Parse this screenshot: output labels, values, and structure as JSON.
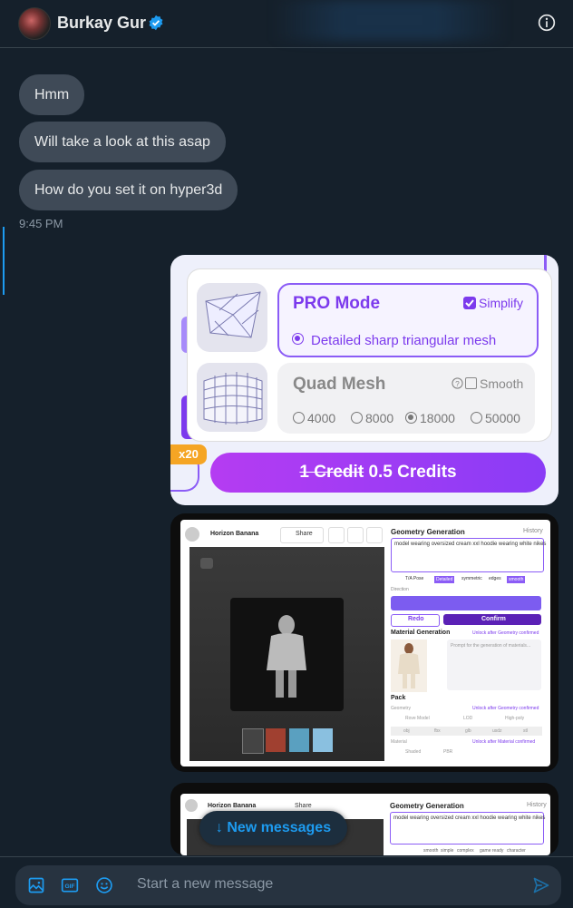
{
  "header": {
    "name": "Burkay Gur"
  },
  "messages": [
    {
      "text": "Hmm"
    },
    {
      "text": "Will take a look at this asap"
    },
    {
      "text": "How do you set it on hyper3d"
    }
  ],
  "timestamp": "9:45 PM",
  "card1": {
    "pro_title": "PRO Mode",
    "simplify": "Simplify",
    "pro_option": "Detailed sharp triangular mesh",
    "quad_title": "Quad Mesh",
    "smooth": "Smooth",
    "quad_options": [
      "4000",
      "8000",
      "18000",
      "50000"
    ],
    "badge": "x20",
    "credit_old": "1 Credit",
    "credit_new": "0.5 Credits"
  },
  "card2": {
    "user": "Horizon Banana",
    "share": "Share",
    "panel_title": "Geometry Generation",
    "history": "History",
    "prompt": "model wearing oversized cream xxl hoodie wearing white nikes",
    "tags": [
      "T/A Pose",
      "Detailed",
      "symmetric",
      "edges",
      "smooth"
    ],
    "direction": "Direction",
    "redo": "Redo",
    "confirm": "Confirm",
    "material_title": "Material Generation",
    "unlock_geo": "Unlock after Geometry confirmed",
    "material_placeholder": "Prompt for the generation of materials...",
    "pack": "Pack",
    "geometry": "Geometry",
    "unlock_geo2": "Unlock after Geometry confirmed",
    "pack_opts": [
      "Rove Model",
      "LOD",
      "High-poly"
    ],
    "formats": [
      "obj",
      "fbx",
      "glb",
      "usdz",
      "stl"
    ],
    "material": "Material",
    "unlock_mat": "Unlock after Material confirmed",
    "mat_opts": [
      "Shaded",
      "PBR"
    ]
  },
  "card3": {
    "user": "Horizon Banana",
    "share": "Share",
    "panel_title": "Geometry Generation",
    "history": "History",
    "prompt": "model wearing oversized cream xxl hoodie wearing white nikes",
    "tags": [
      "smooth",
      "simple",
      "complex",
      "game ready",
      "character"
    ]
  },
  "new_messages": "↓ New messages",
  "composer": {
    "placeholder": "Start a new message"
  },
  "colors": {
    "bg": "#15202b",
    "bubble": "#3f4a57",
    "accent": "#1d9bf0",
    "purple": "#8b5cf6"
  }
}
